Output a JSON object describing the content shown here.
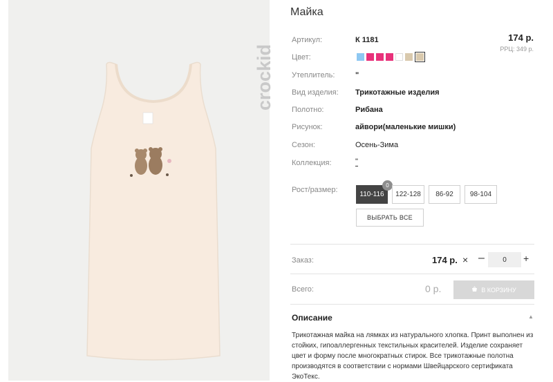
{
  "product": {
    "title": "Майка",
    "price": "174 р.",
    "rrp": "РРЦ: 349 р.",
    "brand": "crockid"
  },
  "attributes": [
    {
      "label": "Артикул:",
      "value": "К 1181"
    },
    {
      "label": "Цвет:",
      "value": ""
    },
    {
      "label": "Утеплитель:",
      "value": "\""
    },
    {
      "label": "Вид изделия:",
      "value": "Трикотажные изделия"
    },
    {
      "label": "Полотно:",
      "value": "Рибана"
    },
    {
      "label": "Рисунок:",
      "value": "айвори(маленькие мишки)"
    },
    {
      "label": "Сезон:",
      "value": "Осень-Зима"
    },
    {
      "label": "Коллекция:",
      "value": "\""
    }
  ],
  "colors": [
    {
      "hex": "#8ec8f2",
      "selected": false
    },
    {
      "hex": "#e8317a",
      "selected": false
    },
    {
      "hex": "#e8317a",
      "selected": false
    },
    {
      "hex": "#e8317a",
      "selected": false
    },
    {
      "hex": "#ffffff",
      "selected": false
    },
    {
      "hex": "#d9c9ad",
      "selected": false
    },
    {
      "hex": "#d9c9ad",
      "selected": true
    }
  ],
  "sizes": {
    "label": "Рост/размер:",
    "options": [
      "110-116",
      "122-128",
      "86-92",
      "98-104"
    ],
    "selected": "110-116",
    "badge": "0",
    "select_all_label": "ВЫБРАТЬ ВСЕ"
  },
  "order": {
    "label": "Заказ:",
    "unit_price": "174 р.",
    "times_symbol": "×",
    "minus": "–",
    "plus": "+",
    "quantity": "0"
  },
  "total": {
    "label": "Всего:",
    "value": "0 р.",
    "cart_button": "В КОРЗИНУ",
    "cart_icon": "basket-icon"
  },
  "description": {
    "heading": "Описание",
    "text": "Трикотажная майка на лямках из натурального хлопка. Принт выполнен из стойких, гипоаллергенных текстильных красителей. Изделие сохраняет цвет и форму после многократных стирок. Все трикотажные полотна производятся в соответствии с нормами Швейцарского сертификата ЭкоТекс."
  }
}
